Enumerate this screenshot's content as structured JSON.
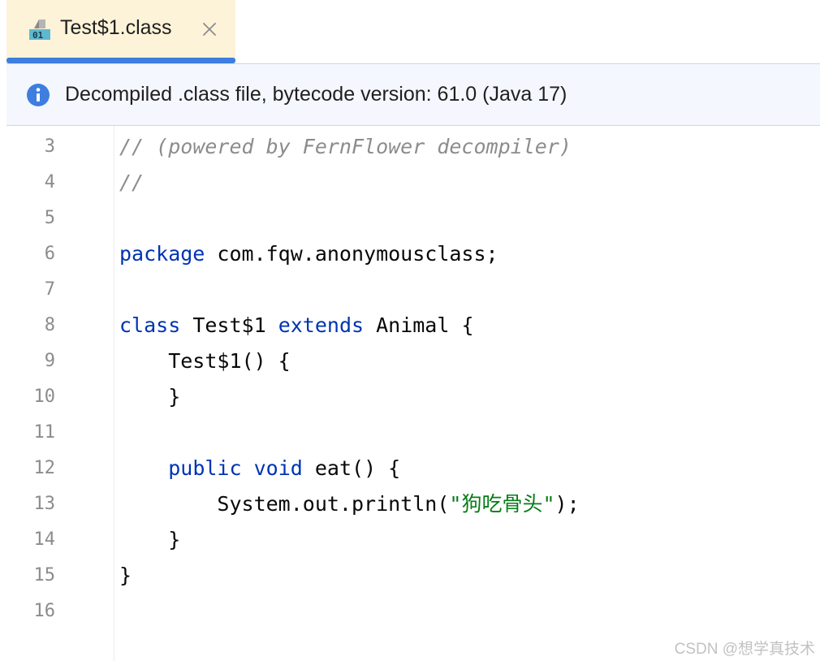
{
  "tab": {
    "title": "Test$1.class",
    "file_icon": "class-file-icon",
    "close_icon": "close-icon"
  },
  "banner": {
    "icon": "info-icon",
    "text": "Decompiled .class file, bytecode version: 61.0 (Java 17)"
  },
  "editor": {
    "lines": [
      {
        "num": "3",
        "tokens": [
          {
            "t": "// (powered by FernFlower decompiler)",
            "k": "cmt"
          }
        ]
      },
      {
        "num": "4",
        "tokens": [
          {
            "t": "//",
            "k": "cmt"
          }
        ]
      },
      {
        "num": "5",
        "tokens": []
      },
      {
        "num": "6",
        "tokens": [
          {
            "t": "package",
            "k": "kw"
          },
          {
            "t": " com.fqw.anonymousclass;",
            "k": "plain"
          }
        ]
      },
      {
        "num": "7",
        "tokens": []
      },
      {
        "num": "8",
        "tokens": [
          {
            "t": "class",
            "k": "kw"
          },
          {
            "t": " Test$1 ",
            "k": "plain"
          },
          {
            "t": "extends",
            "k": "kw"
          },
          {
            "t": " Animal {",
            "k": "plain"
          }
        ]
      },
      {
        "num": "9",
        "tokens": [
          {
            "t": "    Test$1() {",
            "k": "plain"
          }
        ]
      },
      {
        "num": "10",
        "tokens": [
          {
            "t": "    }",
            "k": "plain"
          }
        ]
      },
      {
        "num": "11",
        "tokens": []
      },
      {
        "num": "12",
        "tokens": [
          {
            "t": "    ",
            "k": "plain"
          },
          {
            "t": "public",
            "k": "kw"
          },
          {
            "t": " ",
            "k": "plain"
          },
          {
            "t": "void",
            "k": "kw"
          },
          {
            "t": " eat() {",
            "k": "plain"
          }
        ]
      },
      {
        "num": "13",
        "tokens": [
          {
            "t": "        System.out.println(",
            "k": "plain"
          },
          {
            "t": "\"",
            "k": "str"
          },
          {
            "t": "狗吃骨头",
            "k": "str-cjk"
          },
          {
            "t": "\"",
            "k": "str"
          },
          {
            "t": ");",
            "k": "plain"
          }
        ]
      },
      {
        "num": "14",
        "tokens": [
          {
            "t": "    }",
            "k": "plain"
          }
        ]
      },
      {
        "num": "15",
        "tokens": [
          {
            "t": "}",
            "k": "plain"
          }
        ]
      },
      {
        "num": "16",
        "tokens": []
      }
    ]
  },
  "colors": {
    "tab_active_bg": "#fdf3d9",
    "tab_underline": "#3d7ee0",
    "banner_bg": "#f4f7fd",
    "info_icon": "#3d7ee0",
    "keyword": "#0033b3",
    "comment": "#8c8c8c",
    "string": "#067d17",
    "line_number": "#8c8c8c"
  },
  "watermark": "CSDN @想学真技术"
}
